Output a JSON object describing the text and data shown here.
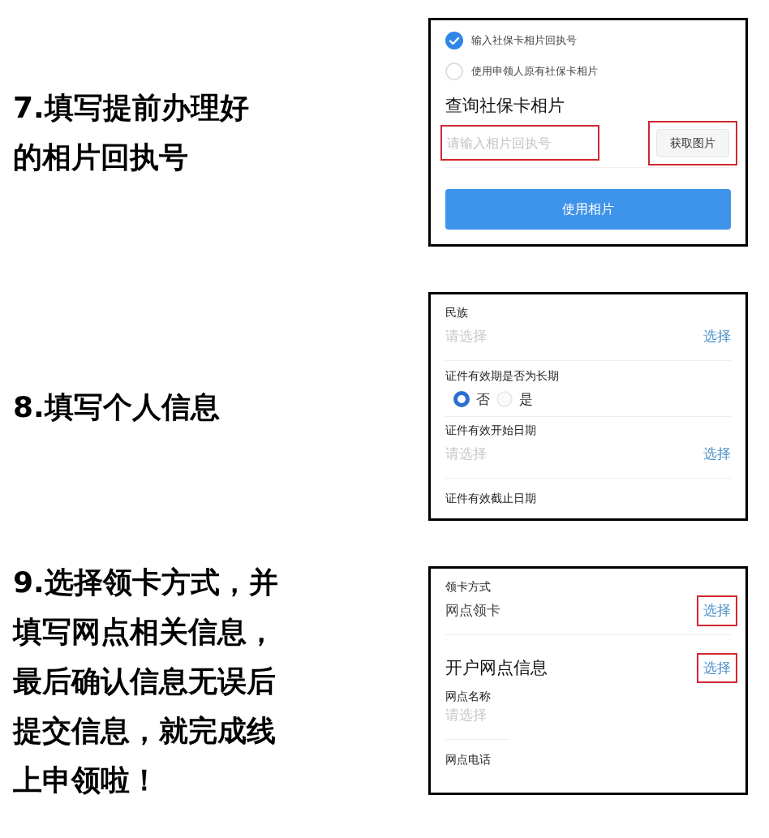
{
  "steps": [
    {
      "caption_lines": [
        "7.填写提前办理好",
        "的相片回执号"
      ],
      "panel": [
        {
          "kind": "choice",
          "label": "输入社保卡相片回执号",
          "selected": true
        },
        {
          "kind": "choice",
          "label": "使用申领人原有社保卡相片",
          "selected": false
        },
        {
          "kind": "heading",
          "title": "查询社保卡相片"
        },
        {
          "kind": "input_row",
          "placeholder": "请输入相片回执号",
          "highlighted": true,
          "button": {
            "label": "获取图片",
            "highlighted": true
          }
        },
        {
          "kind": "primary_button",
          "label": "使用相片"
        }
      ]
    },
    {
      "caption_lines": [
        "8.填写个人信息"
      ],
      "panel": [
        {
          "kind": "select",
          "label": "民族",
          "placeholder": "请选择",
          "action": "选择",
          "action_highlighted": false
        },
        {
          "kind": "radio_group",
          "label": "证件有效期是否为长期",
          "options": [
            {
              "label": "否",
              "selected": true
            },
            {
              "label": "是",
              "selected": false
            }
          ]
        },
        {
          "kind": "select",
          "label": "证件有效开始日期",
          "placeholder": "请选择",
          "action": "选择",
          "action_highlighted": false
        },
        {
          "kind": "label",
          "label": "证件有效截止日期"
        }
      ]
    },
    {
      "caption_lines": [
        "9.选择领卡方式，并",
        "填写网点相关信息，",
        "最后确认信息无误后",
        "提交信息，就完成线",
        "上申领啦！"
      ],
      "panel": [
        {
          "kind": "select",
          "label": "领卡方式",
          "value": "网点领卡",
          "action": "选择",
          "action_highlighted": true
        },
        {
          "kind": "section",
          "title": "开户网点信息",
          "action": "选择",
          "action_highlighted": true
        },
        {
          "kind": "select",
          "label": "网点名称",
          "placeholder": "请选择",
          "short_divider": true
        },
        {
          "kind": "label",
          "label": "网点电话"
        }
      ]
    }
  ]
}
